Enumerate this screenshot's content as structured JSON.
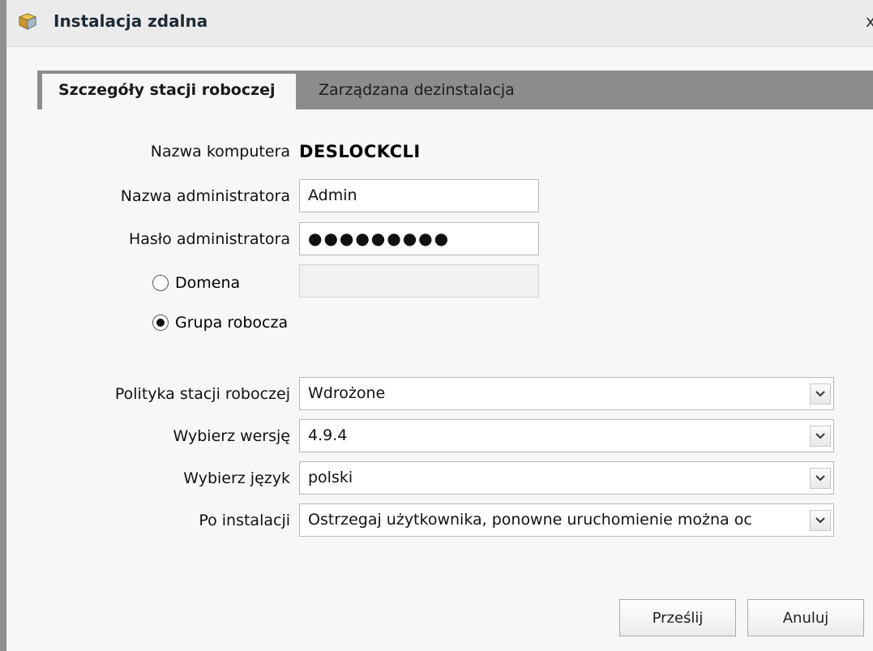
{
  "window": {
    "title": "Instalacja zdalna",
    "icon": "package-icon",
    "close_glyph": "x"
  },
  "tabs": [
    {
      "label": "Szczegóły stacji roboczej",
      "active": true
    },
    {
      "label": "Zarządzana dezinstalacja",
      "active": false
    }
  ],
  "form": {
    "computer_name_label": "Nazwa komputera",
    "computer_name_value": "DESLOCKCLI",
    "admin_name_label": "Nazwa administratora",
    "admin_name_value": "Admin",
    "admin_password_label": "Hasło administratora",
    "admin_password_value": "●●●●●●●●●",
    "domain_radio_label": "Domena",
    "domain_selected": false,
    "domain_value": "",
    "workgroup_radio_label": "Grupa robocza",
    "workgroup_selected": true,
    "policy_label": "Polityka stacji roboczej",
    "policy_value": "Wdrożone",
    "version_label": "Wybierz wersję",
    "version_value": "4.9.4",
    "language_label": "Wybierz język",
    "language_value": "polski",
    "after_install_label": "Po instalacji",
    "after_install_value": "Ostrzegaj użytkownika, ponowne uruchomienie można oc"
  },
  "buttons": {
    "submit_label": "Prześlij",
    "cancel_label": "Anuluj"
  },
  "colors": {
    "tab_bar": "#8c8c8c",
    "background": "#f7f7f7",
    "title_text": "#1d2a38"
  }
}
